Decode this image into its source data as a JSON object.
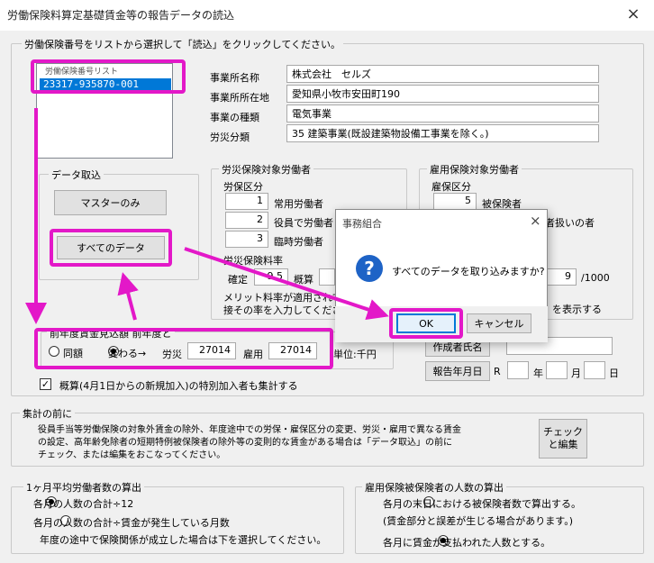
{
  "window": {
    "title": "労働保険料算定基礎賃金等の報告データの読込",
    "close_glyph": "×"
  },
  "instruction": "労働保険番号をリストから選択して「読込」をクリックしてください。",
  "list": {
    "header": "労働保険番号リスト",
    "items": [
      "23317-935870-001"
    ]
  },
  "office": {
    "name_label": "事業所名称",
    "name": "株式会社　セルズ",
    "address_label": "事業所所在地",
    "address": "愛知県小牧市安田町190",
    "type_label": "事業の種類",
    "type": "電気事業",
    "category_label": "労災分類",
    "category": "35 建築事業(既設建築物設備工事業を除く。)"
  },
  "import_group": {
    "title": "データ取込",
    "master_button": "マスターのみ",
    "all_button": "すべてのデータ"
  },
  "rosai_group": {
    "title": "労災保険対象労働者",
    "class_label": "労保区分",
    "rows": [
      {
        "code": "1",
        "label": "常用労働者"
      },
      {
        "code": "2",
        "label": "役員で労働者"
      },
      {
        "code": "3",
        "label": "臨時労働者"
      }
    ],
    "rate_label": "労災保険料率",
    "confirmed_label": "確定",
    "confirmed_value": "9.5",
    "estimate_label": "概算",
    "merit_note_1": "メリット料率が適用されて",
    "merit_note_2": "接その率を入力してくださ"
  },
  "koyo_group": {
    "title": "雇用保険対象労働者",
    "class_label": "雇保区分",
    "rows": [
      {
        "code": "5",
        "label": "被保険者"
      }
    ],
    "partial_label_2": "者扱いの者",
    "rate_value": "9",
    "rate_unit": "/1000",
    "partial_label_3": "を表示する"
  },
  "prev_year": {
    "title": "前年度賃金見込額 前年度と",
    "radio_same": "同額",
    "radio_change": "変わる→",
    "rosai_label": "労災",
    "rosai_value": "27014",
    "koyo_label": "雇用",
    "koyo_value": "27014",
    "unit": "単位:千円"
  },
  "author_button": "作成者氏名",
  "report_date": {
    "button": "報告年月日",
    "era": "R",
    "year_unit": "年",
    "month_unit": "月",
    "day_unit": "日"
  },
  "special_check": {
    "checked": "✓",
    "label": "概算(4月1日からの新規加入)の特別加入者も集計する"
  },
  "before_total": {
    "title": "集計の前に",
    "line1": "役員手当等労働保険の対象外賃金の除外、年度途中での労保・雇保区分の変更、労災・雇用で異なる賃金",
    "line2": "の設定、高年齢免除者の短期特例被保険者の除外等の変則的な賃金がある場合は「データ取込」の前に",
    "line3": "チェック、または編集をおこなってください。",
    "check_button_1": "チェック",
    "check_button_2": "と編集"
  },
  "monthly_avg": {
    "title": "1ヶ月平均労働者数の算出",
    "option1": "各月の人数の合計÷12",
    "option2": "各月の人数の合計÷賃金が発生している月数",
    "note": "年度の途中で保険関係が成立した場合は下を選択してください。"
  },
  "insured_count": {
    "title": "雇用保険被保険者の人数の算出",
    "option1": "各月の末日における被保険者数で算出する。",
    "note": "(賃金部分と誤差が生じる場合があります。)",
    "option2": "各月に賃金が支払われた人数とする。"
  },
  "dialog": {
    "title": "事務組合",
    "close_glyph": "×",
    "icon": "?",
    "message": "すべてのデータを取り込みますか?",
    "ok": "OK",
    "cancel": "キャンセル"
  },
  "colors": {
    "highlight": "#e318c8",
    "selection": "#0078d7",
    "info_icon": "#1e63c6"
  }
}
